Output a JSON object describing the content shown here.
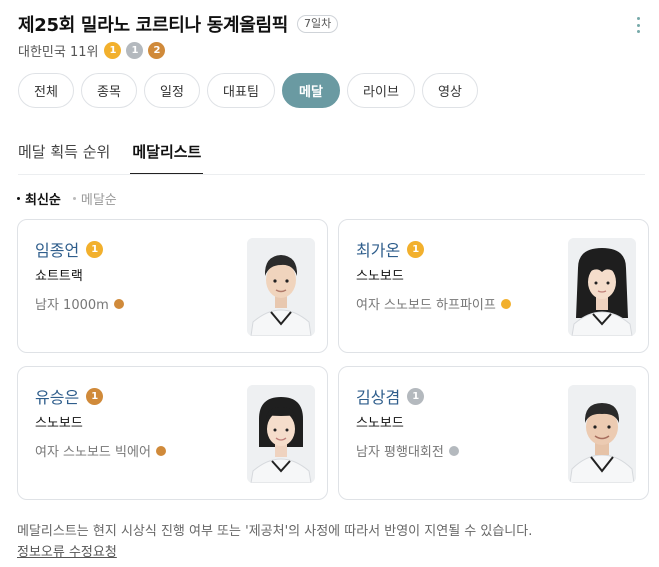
{
  "header": {
    "title": "제25회 밀라노 코르티나 동계올림픽",
    "day_badge": "7일차",
    "country_rank": "대한민국 11위",
    "medals": [
      {
        "type": "gold",
        "count": "1",
        "color": "#f2b02d"
      },
      {
        "type": "silver",
        "count": "1",
        "color": "#b4b9be"
      },
      {
        "type": "bronze",
        "count": "2",
        "color": "#d08a3a"
      }
    ]
  },
  "tabs": [
    {
      "label": "전체",
      "active": false
    },
    {
      "label": "종목",
      "active": false
    },
    {
      "label": "일정",
      "active": false
    },
    {
      "label": "대표팀",
      "active": false
    },
    {
      "label": "메달",
      "active": true
    },
    {
      "label": "라이브",
      "active": false
    },
    {
      "label": "영상",
      "active": false
    }
  ],
  "subtabs": [
    {
      "label": "메달 획득 순위",
      "active": false
    },
    {
      "label": "메달리스트",
      "active": true
    }
  ],
  "sort": [
    {
      "label": "최신순",
      "active": true
    },
    {
      "label": "메달순",
      "active": false
    }
  ],
  "medalists": [
    {
      "name": "임종언",
      "medal": "gold",
      "medal_count": "1",
      "sport": "쇼트트랙",
      "event": "남자 1000m",
      "event_medal_color": "#d08a3a",
      "photo": "athlete-photo"
    },
    {
      "name": "최가온",
      "medal": "gold",
      "medal_count": "1",
      "sport": "스노보드",
      "event": "여자 스노보드 하프파이프",
      "event_medal_color": "#f2b02d",
      "photo": "athlete-photo"
    },
    {
      "name": "유승은",
      "medal": "bronze",
      "medal_count": "1",
      "sport": "스노보드",
      "event": "여자 스노보드 빅에어",
      "event_medal_color": "#d08a3a",
      "photo": "athlete-photo"
    },
    {
      "name": "김상겸",
      "medal": "silver",
      "medal_count": "1",
      "sport": "스노보드",
      "event": "남자 평행대회전",
      "event_medal_color": "#b4b9be",
      "photo": "athlete-photo"
    }
  ],
  "footer": {
    "notice": "메달리스트는 현지 시상식 진행 여부 또는 '제공처'의 사정에 따라서 반영이 지연될 수 있습니다.",
    "report_link": "정보오류 수정요청"
  }
}
